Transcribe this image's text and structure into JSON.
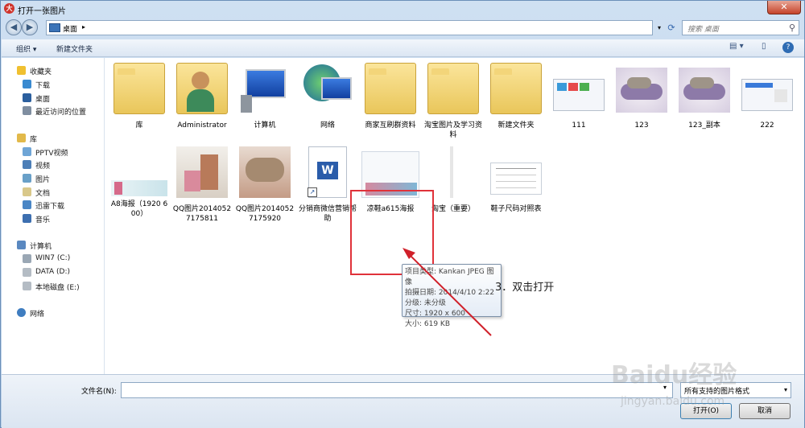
{
  "window": {
    "title": "打开一张图片",
    "title_icon_glyph": "大",
    "close_glyph": "✕"
  },
  "address_bar": {
    "path": "桌面",
    "chevron": "▸",
    "search_placeholder": "搜索 桌面"
  },
  "command_bar": {
    "organize": "组织 ▾",
    "new_folder": "新建文件夹"
  },
  "nav_pane": {
    "favorites": {
      "label": "收藏夹",
      "items": [
        "下载",
        "桌面",
        "最近访问的位置"
      ]
    },
    "libraries": {
      "label": "库",
      "items": [
        "PPTV视频",
        "视频",
        "图片",
        "文档",
        "迅雷下载",
        "音乐"
      ]
    },
    "computer": {
      "label": "计算机",
      "items": [
        "WIN7 (C:)",
        "DATA (D:)",
        "本地磁盘 (E:)"
      ]
    },
    "network": {
      "label": "网络"
    }
  },
  "files": [
    {
      "name": "库",
      "kind": "library"
    },
    {
      "name": "Administrator",
      "kind": "user"
    },
    {
      "name": "计算机",
      "kind": "computer"
    },
    {
      "name": "网络",
      "kind": "network"
    },
    {
      "name": "商家互刷群资料",
      "kind": "folder"
    },
    {
      "name": "淘宝图片及学习资料",
      "kind": "folder"
    },
    {
      "name": "新建文件夹",
      "kind": "folder"
    },
    {
      "name": "111",
      "kind": "image"
    },
    {
      "name": "123",
      "kind": "image"
    },
    {
      "name": "123_副本",
      "kind": "image"
    },
    {
      "name": "222",
      "kind": "image"
    },
    {
      "name": "A8海报（1920 600）",
      "kind": "image"
    },
    {
      "name": "QQ图片20140527175811",
      "kind": "image"
    },
    {
      "name": "QQ图片20140527175920",
      "kind": "image"
    },
    {
      "name": "分销商微信营销帮助",
      "kind": "doc"
    },
    {
      "name": "凉鞋a615海报",
      "kind": "image"
    },
    {
      "name": "淘宝（重要）",
      "kind": "image"
    },
    {
      "name": "鞋子尺码对照表",
      "kind": "image"
    }
  ],
  "tooltip": {
    "type": "项目类型: Kankan JPEG 图像",
    "date": "拍摄日期: 2014/4/10 2:22",
    "rating": "分级: 未分级",
    "size": "尺寸: 1920 x 600",
    "filesize": "大小: 619 KB"
  },
  "annotation": "3．双击打开",
  "bottom": {
    "filename_label": "文件名(N):",
    "filename_value": "",
    "filter": "所有支持的图片格式",
    "open_label": "打开(O)",
    "cancel_label": "取消"
  },
  "watermark": {
    "brand": "Baidu经验",
    "url": "jingyan.baidu.com"
  },
  "colors": {
    "selection_border": "#e0323a",
    "arrow": "#d0202a"
  }
}
